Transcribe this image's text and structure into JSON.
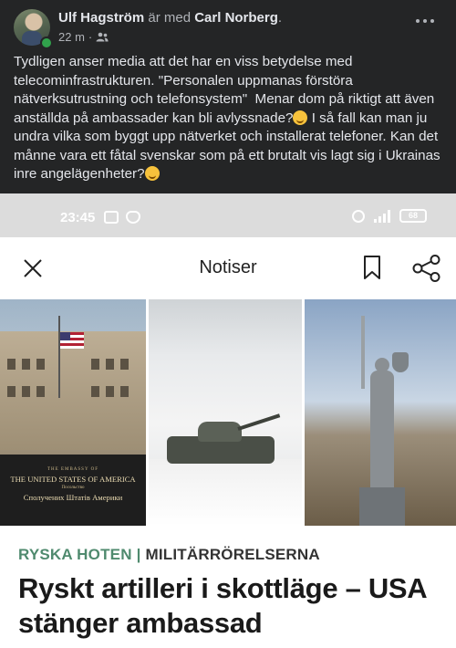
{
  "post": {
    "author": "Ulf Hagström",
    "with_text": "är med",
    "tagged": "Carl Norberg",
    "tagged_suffix": ".",
    "time": "22 m",
    "audience_icon": "friends-icon",
    "text_part1": "Tydligen anser media att det har en viss betydelse med telecominfrastrukturen. \"Personalen uppmanas förstöra nätverksutrustning och telefonsystem\"  Menar dom på riktigt att även anställda på ambassader kan bli avlyssnade?",
    "text_part2": " I så fall kan man ju undra vilka som byggt upp nätverket och installerat telefoner. Kan det månne vara ett fåtal svenskar som på ett brutalt vis lagt sig i Ukrainas inre angelägenheter?"
  },
  "screenshot": {
    "status_time": "23:45",
    "battery": "68",
    "app_title": "Notiser",
    "sign_line1": "THE EMBASSY OF",
    "sign_line2": "THE UNITED STATES OF AMERICA",
    "sign_line3": "Посольство",
    "sign_line4": "Сполучених Штатів Америки",
    "kicker1": "RYSKA HOTEN",
    "kicker_sep": " | ",
    "kicker2": "MILITÄRRÖRELSERNA",
    "headline": "Ryskt artilleri i skottläge – USA stänger ambassad"
  }
}
